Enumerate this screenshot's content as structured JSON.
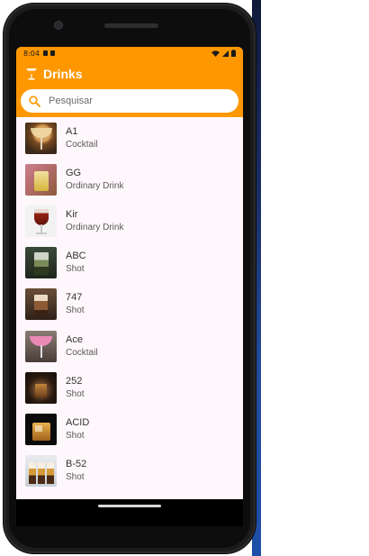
{
  "statusbar": {
    "time": "8:04"
  },
  "appbar": {
    "title": "Drinks"
  },
  "search": {
    "placeholder": "Pesquisar"
  },
  "colors": {
    "accent": "#ff9800",
    "surface": "#fef7fb"
  },
  "drinks": [
    {
      "name": "A1",
      "category": "Cocktail",
      "thumb": "cocktail-glass-amber"
    },
    {
      "name": "GG",
      "category": "Ordinary Drink",
      "thumb": "highball-yellow"
    },
    {
      "name": "Kir",
      "category": "Ordinary Drink",
      "thumb": "wine-glass-red"
    },
    {
      "name": "ABC",
      "category": "Shot",
      "thumb": "layered-shot-green"
    },
    {
      "name": "747",
      "category": "Shot",
      "thumb": "layered-shot-brown"
    },
    {
      "name": "Ace",
      "category": "Cocktail",
      "thumb": "cocktail-glass-pink"
    },
    {
      "name": "252",
      "category": "Shot",
      "thumb": "shot-glass-dark"
    },
    {
      "name": "ACID",
      "category": "Shot",
      "thumb": "whiskey-glass-ice"
    },
    {
      "name": "B-52",
      "category": "Shot",
      "thumb": "layered-shots-b52"
    }
  ]
}
